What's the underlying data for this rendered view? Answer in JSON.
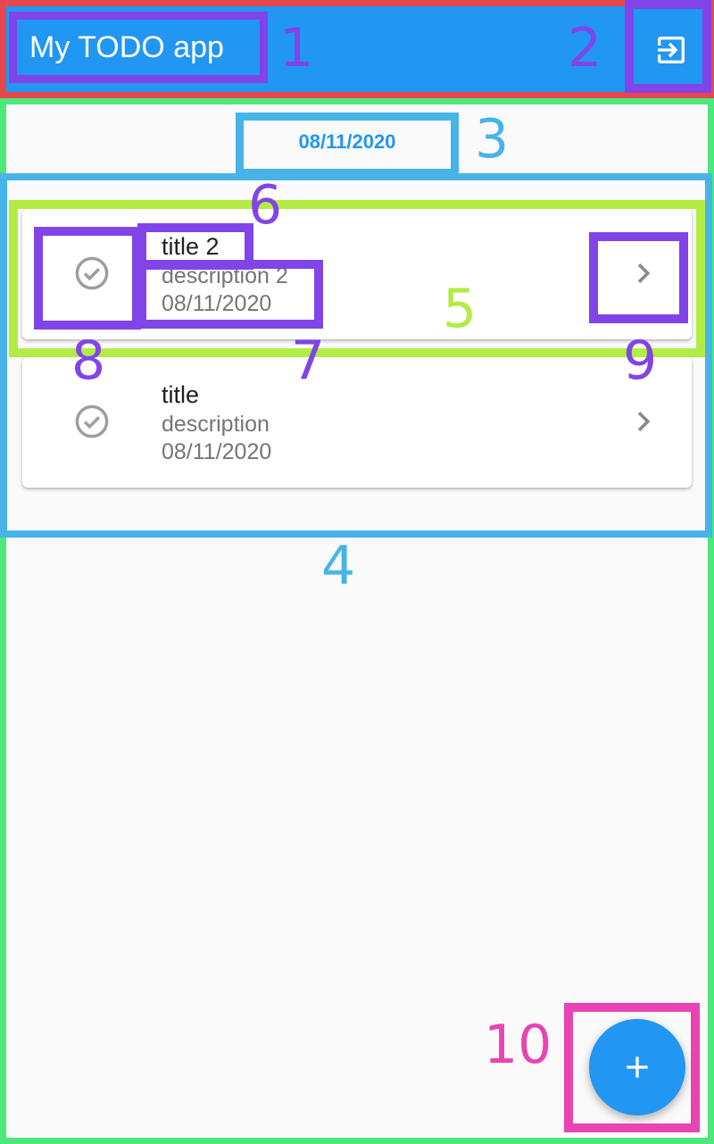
{
  "appbar": {
    "title": "My TODO app",
    "logout_icon": "exit-to-app-icon",
    "background_color": "#2196f3"
  },
  "date_selector": {
    "label": "08/11/2020",
    "color": "#2196f3"
  },
  "todos": [
    {
      "title": "title 2",
      "description": "description 2",
      "date": "08/11/2020",
      "check_icon": "check-circle-outline-icon",
      "open_icon": "chevron-right-icon"
    },
    {
      "title": "title",
      "description": "description",
      "date": "08/11/2020",
      "check_icon": "check-circle-outline-icon",
      "open_icon": "chevron-right-icon"
    }
  ],
  "fab": {
    "icon": "plus-icon",
    "color": "#2196f3"
  },
  "annotations": {
    "labels": [
      "1",
      "2",
      "3",
      "4",
      "5",
      "6",
      "7",
      "8",
      "9",
      "10"
    ],
    "colors": {
      "appbar": "#e8474e",
      "primary": "#8044e8",
      "list": "#47b4e8",
      "body": "#4ce87c",
      "card": "#b2ec44",
      "fab": "#e844b4"
    }
  }
}
